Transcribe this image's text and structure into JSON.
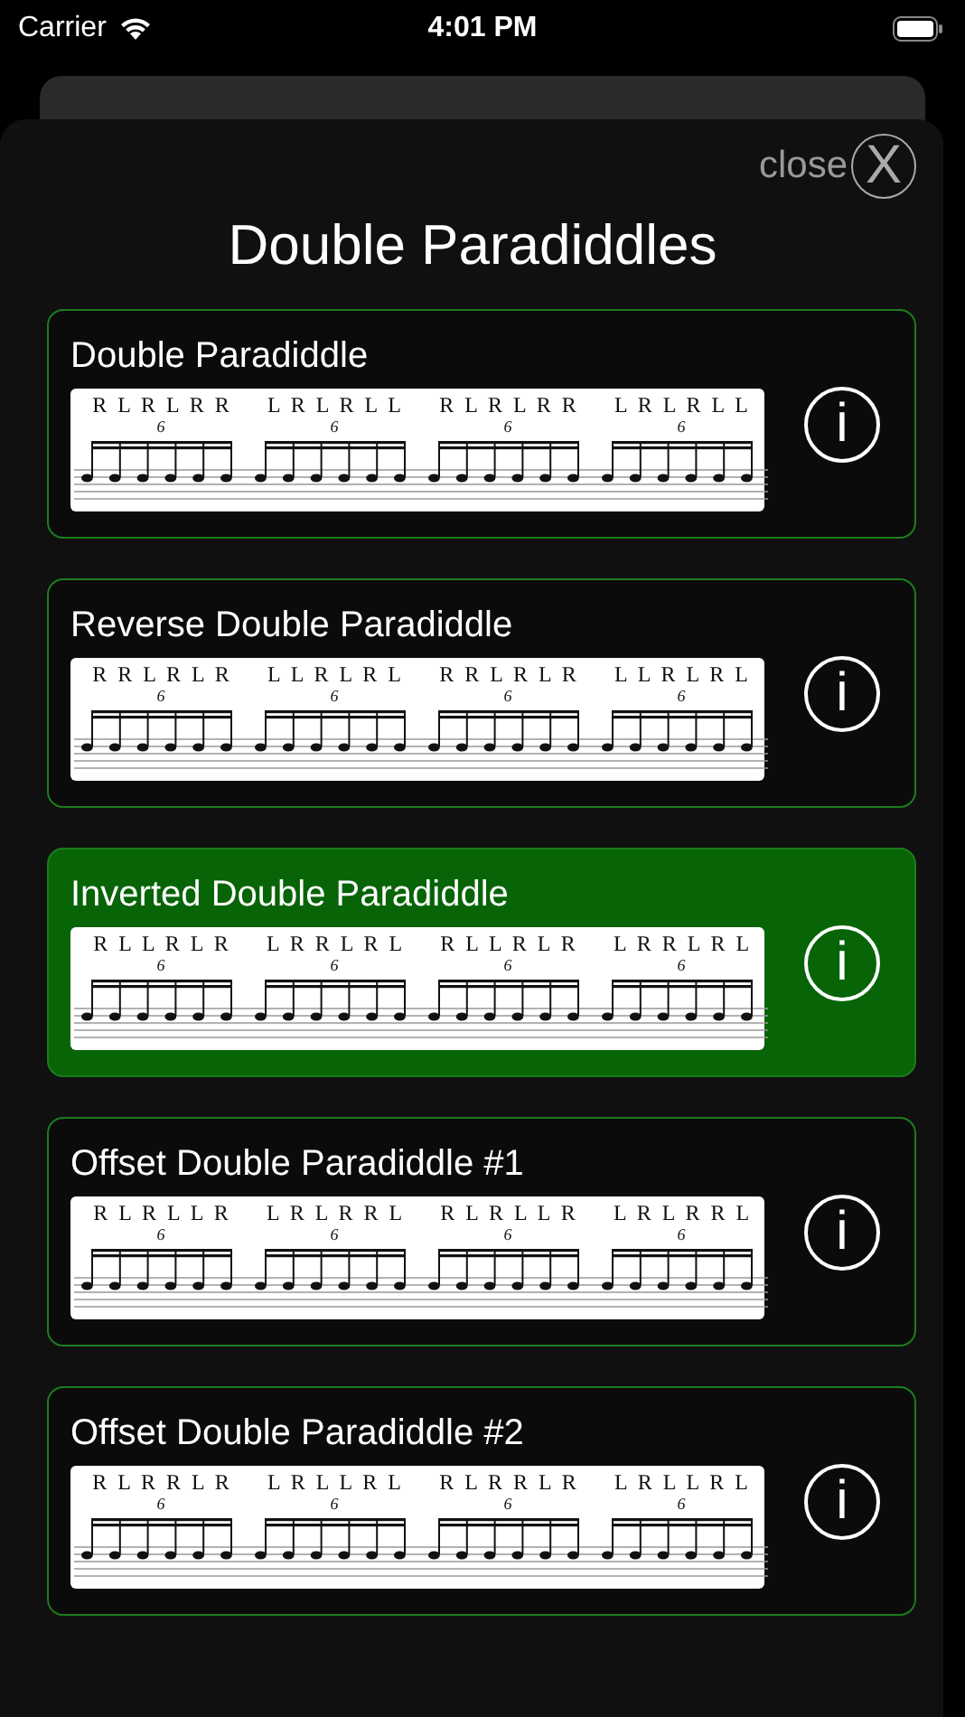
{
  "status_bar": {
    "carrier": "Carrier",
    "time": "4:01 PM"
  },
  "modal": {
    "close_label": "close",
    "close_icon": "X",
    "title": "Double Paradiddles",
    "rudiments": [
      {
        "name": "Double Paradiddle",
        "selected": false,
        "info": "i",
        "groups": [
          {
            "sticking": "R L R L R R",
            "tuplet": "6"
          },
          {
            "sticking": "L R L R L L",
            "tuplet": "6"
          },
          {
            "sticking": "R L R L R R",
            "tuplet": "6"
          },
          {
            "sticking": "L R L R L L",
            "tuplet": "6"
          }
        ]
      },
      {
        "name": "Reverse Double Paradiddle",
        "selected": false,
        "info": "i",
        "groups": [
          {
            "sticking": "R R L R L R",
            "tuplet": "6"
          },
          {
            "sticking": "L L R L R L",
            "tuplet": "6"
          },
          {
            "sticking": "R R L R L R",
            "tuplet": "6"
          },
          {
            "sticking": "L L R L R L",
            "tuplet": "6"
          }
        ]
      },
      {
        "name": "Inverted Double Paradiddle",
        "selected": true,
        "info": "i",
        "groups": [
          {
            "sticking": "R L L R L R",
            "tuplet": "6"
          },
          {
            "sticking": "L R R L R L",
            "tuplet": "6"
          },
          {
            "sticking": "R L L R L R",
            "tuplet": "6"
          },
          {
            "sticking": "L R R L R L",
            "tuplet": "6"
          }
        ]
      },
      {
        "name": "Offset Double Paradiddle #1",
        "selected": false,
        "info": "i",
        "groups": [
          {
            "sticking": "R L R L L R",
            "tuplet": "6"
          },
          {
            "sticking": "L R L R R L",
            "tuplet": "6"
          },
          {
            "sticking": "R L R L L R",
            "tuplet": "6"
          },
          {
            "sticking": "L R L R R L",
            "tuplet": "6"
          }
        ]
      },
      {
        "name": "Offset Double Paradiddle #2",
        "selected": false,
        "info": "i",
        "groups": [
          {
            "sticking": "R L R R L R",
            "tuplet": "6"
          },
          {
            "sticking": "L R L L R L",
            "tuplet": "6"
          },
          {
            "sticking": "R L R R L R",
            "tuplet": "6"
          },
          {
            "sticking": "L R L L R L",
            "tuplet": "6"
          }
        ]
      }
    ]
  }
}
